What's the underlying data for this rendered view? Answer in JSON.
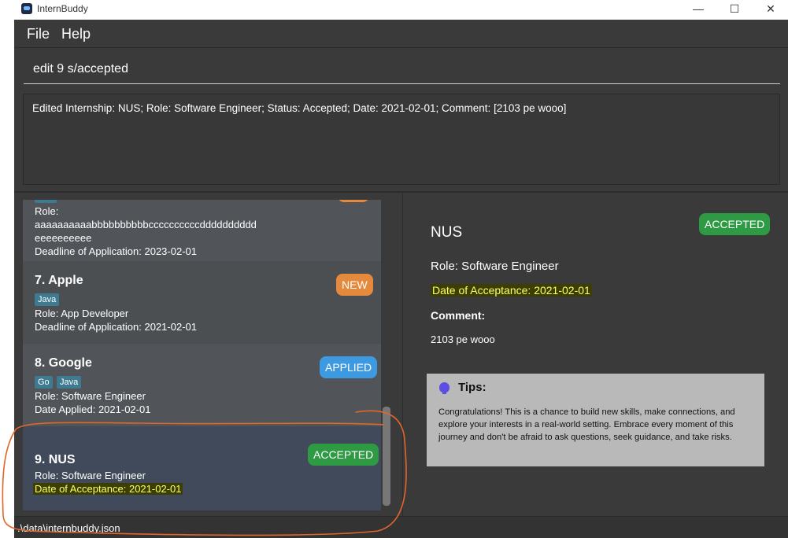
{
  "window": {
    "title": "InternBuddy",
    "controls": {
      "minimize": "—",
      "maximize": "☐",
      "close": "✕"
    }
  },
  "menu": {
    "items": [
      "File",
      "Help"
    ]
  },
  "command_box": {
    "value": "edit 9 s/accepted"
  },
  "result_display": {
    "text": "Edited Internship: NUS; Role: Software Engineer; Status: Accepted; Date: 2021-02-01; Comment: [2103 pe wooo]"
  },
  "list": {
    "partial_card": {
      "role_label": "Role:",
      "role_line1": "aaaaaaaaaabbbbbbbbbbccccccccccdddddddddd",
      "role_line2": "eeeeeeeeee",
      "date": "Deadline of Application: 2023-02-01"
    },
    "cards": [
      {
        "title": "7.  Apple",
        "tags": [
          "Java"
        ],
        "role": "Role: App Developer",
        "date": "Deadline of Application: 2021-02-01",
        "status": "NEW",
        "status_color": "#e58a3c",
        "bg": "#4c4f52"
      },
      {
        "title": "8.  Google",
        "tags": [
          "Go",
          "Java"
        ],
        "role": "Role: Software Engineer",
        "date": "Date Applied: 2021-02-01",
        "status": "APPLIED",
        "status_color": "#3d9ae0",
        "bg": "#515559"
      },
      {
        "title": "9.  NUS",
        "tags": [],
        "role": "Role: Software Engineer",
        "date": "Date of Acceptance: 2021-02-01",
        "status": "ACCEPTED",
        "status_color": "#2e9a44",
        "bg": "#404a5a"
      }
    ]
  },
  "detail": {
    "company": "NUS",
    "status": "ACCEPTED",
    "status_color": "#2e9a44",
    "role": "Role: Software Engineer",
    "date": "Date of Acceptance: 2021-02-01",
    "comment_label": "Comment:",
    "comment": "2103 pe wooo",
    "tips": {
      "title": "Tips:",
      "body": "Congratulations! This is a chance to build new skills, make connections, and explore your interests in a real-world setting. Embrace every moment of this journey and don't be afraid to ask questions, seek guidance, and take risks."
    }
  },
  "status_bar": {
    "path": ".\\data\\internbuddy.json"
  },
  "colors": {
    "highlight_text": "#ffff66",
    "highlight_bg": "#3b3f05",
    "annotation": "#e0662a"
  }
}
